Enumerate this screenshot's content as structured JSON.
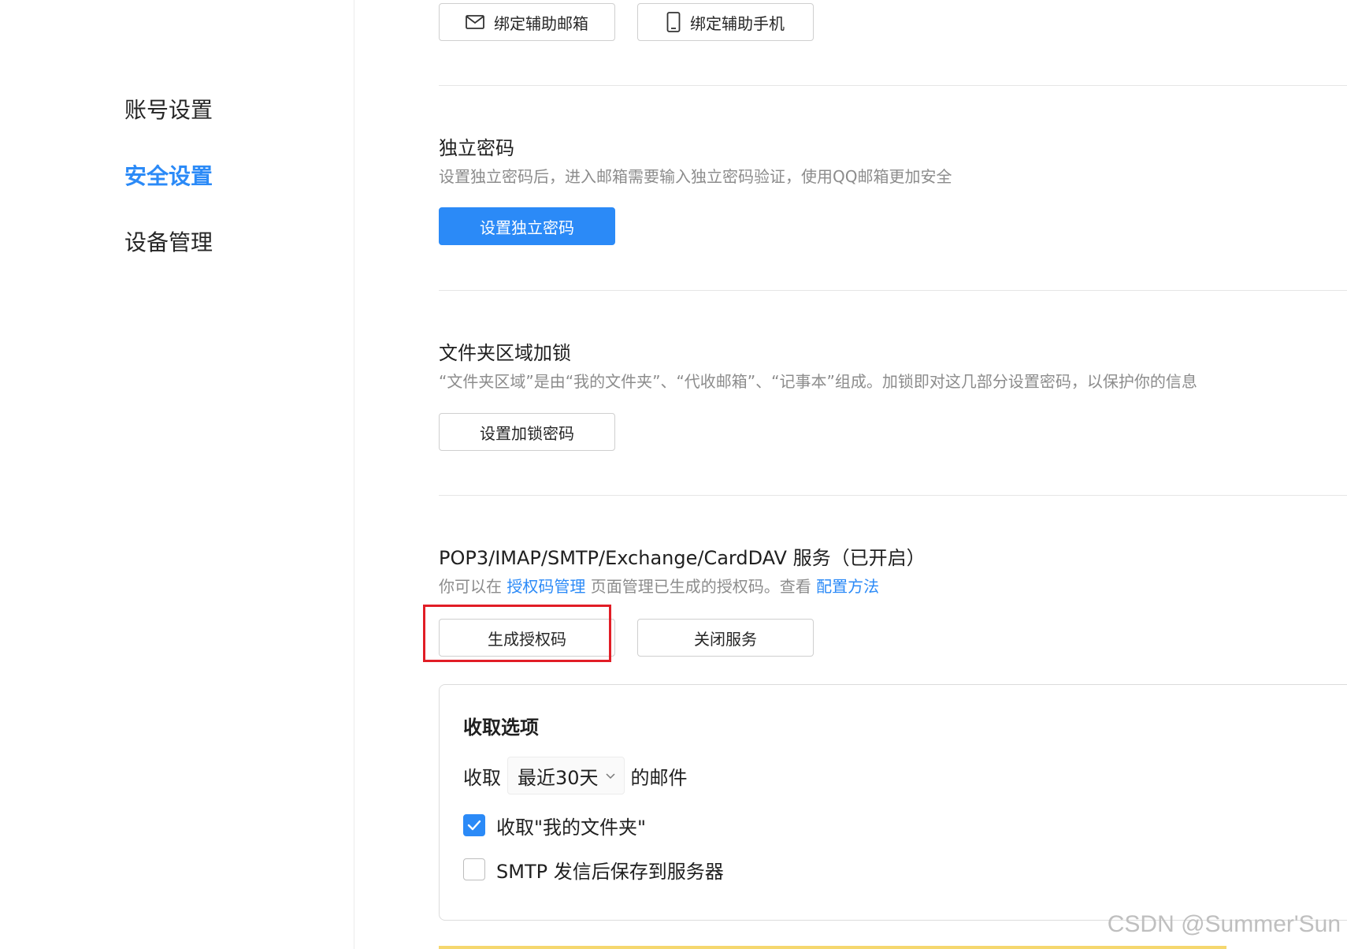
{
  "sidebar": {
    "items": [
      {
        "label": "账号设置",
        "active": false
      },
      {
        "label": "安全设置",
        "active": true
      },
      {
        "label": "设备管理",
        "active": false
      }
    ]
  },
  "bind_buttons": {
    "email_label": "绑定辅助邮箱",
    "email_icon": "mail-icon",
    "phone_label": "绑定辅助手机",
    "phone_icon": "phone-icon"
  },
  "independent_password": {
    "title": "独立密码",
    "description": "设置独立密码后，进入邮箱需要输入独立密码验证，使用QQ邮箱更加安全",
    "button_label": "设置独立密码"
  },
  "folder_lock": {
    "title": "文件夹区域加锁",
    "description": "“文件夹区域”是由“我的文件夹”、“代收邮箱”、“记事本”组成。加锁即对这几部分设置密码，以保护你的信息",
    "button_label": "设置加锁密码"
  },
  "pop3_service": {
    "title": "POP3/IMAP/SMTP/Exchange/CardDAV 服务（已开启）",
    "desc_prefix": "你可以在",
    "desc_link1": "授权码管理",
    "desc_middle": "页面管理已生成的授权码。查看",
    "desc_link2": "配置方法",
    "generate_button_label": "生成授权码",
    "close_button_label": "关闭服务"
  },
  "fetch_options": {
    "title": "收取选项",
    "fetch_prefix": "收取",
    "range_selected": "最近30天",
    "fetch_suffix": "的邮件",
    "options": [
      {
        "label": "收取\"我的文件夹\"",
        "checked": true
      },
      {
        "label": "SMTP 发信后保存到服务器",
        "checked": false
      }
    ]
  },
  "watermark": "CSDN @Summer'Sun",
  "colors": {
    "accent": "#2b8af7",
    "highlight": "#e11d26"
  }
}
